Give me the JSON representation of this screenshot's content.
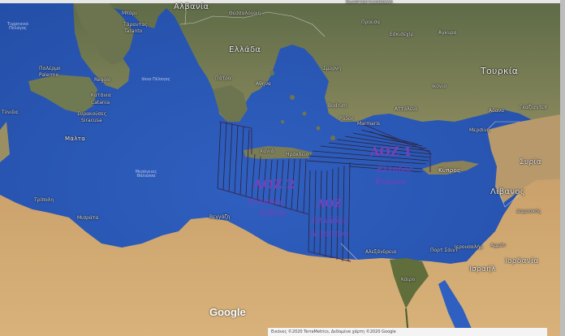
{
  "map": {
    "countries": {
      "albania": "Αλβανία",
      "greece": "Ελλάδα",
      "turkey": "Τουρκία",
      "malta": "Μάλτα",
      "cyprus": "Κύπρος",
      "lebanon": "Λίβανος",
      "israel": "Ισραήλ",
      "jordan": "Ιορδανία",
      "syria": "Συρία"
    },
    "cities": {
      "thessaloniki": "Θεσσαλονίκη",
      "constantinople": "Κωνσταντινούπολη",
      "ankara": "Άγκυρα",
      "bursa": "Προύσα",
      "eskisehir": "Εσκισεχίρ",
      "smyrna": "Σμύρνη",
      "athens": "Αθήνα",
      "patras": "Πάτρα",
      "palermo_el": "Παλέρμο",
      "palermo": "Palermo",
      "catania_el": "Κατάνια",
      "catania": "Catania",
      "syracuse_el": "Συρακούσες",
      "syracuse": "Siracusa",
      "reggio": "Reggio",
      "bari": "Μπάρι",
      "taranto": "Τάραντας",
      "taranto_it": "Taranto",
      "antalya": "Αττάλεια",
      "konya": "Ικόνιο",
      "adana": "Άδανα",
      "gaziantep": "Γκαζιαντέπ",
      "mersin": "Μερσίνη",
      "tripoli": "Τρίπολη",
      "misrata": "Μισράτα",
      "benghazi": "Βεγγάζη",
      "alexandria": "Αλεξάνδρεια",
      "cairo": "Κάιρο",
      "port_said": "Πορτ Σάιντ",
      "jerusalem": "Ιερουσαλήμ",
      "amman": "Αμμάν",
      "chania": "Χανιά",
      "heraklion": "Ηράκλειο",
      "rhodes": "Ρόδος",
      "marmaris": "Marmaris",
      "bodrum": "Bodrum",
      "damascus": "Δαμασκός",
      "tyrhenian": "Τυρρηνικό Πέλαγος",
      "ionian": "Ιόνιο Πέλαγος",
      "mediterranean": "Μεσόγειος Θάλασσα",
      "tunis": "Τύνιδα"
    },
    "annotations": {
      "aoz1": "ΑΟΖ 1",
      "aoz1_text1": "Ελλάδος",
      "aoz1_text2": "Κύπρου",
      "aoz2": "ΑΟΖ 2",
      "aoz2_text1": "Ελλάδος",
      "aoz2_text2": "Λιβύης",
      "aoz3": "ΑΟΖ",
      "aoz3_text1": "Ελλάδος",
      "aoz3_text2": "Αιγύπτου"
    },
    "google_logo": "Google",
    "attribution": "Εικόνες ©2020 TerraMetrics, Δεδομένα χάρτη ©2020 Google",
    "colors": {
      "sea": "#2d59b9",
      "land_north": "#6a7350",
      "desert": "#c9a26a",
      "ink": "#7a3fb8"
    }
  }
}
